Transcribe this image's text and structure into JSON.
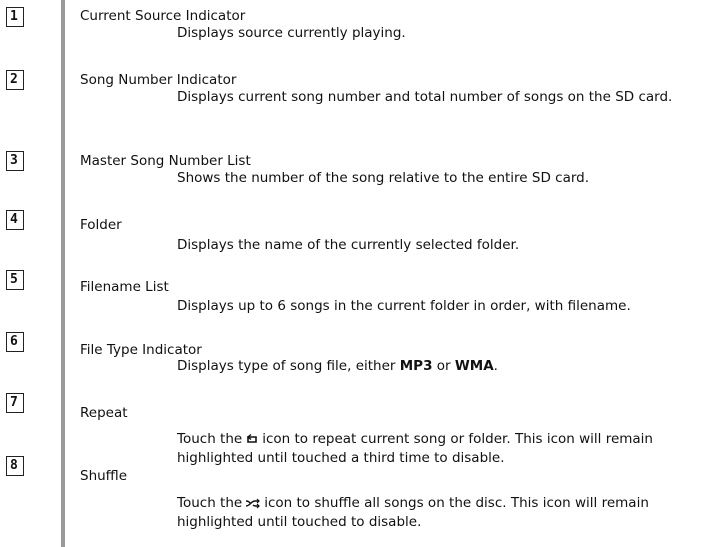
{
  "items": [
    {
      "number": "1",
      "title": "Current Source Indicator",
      "desc": "Displays source currently playing."
    },
    {
      "number": "2",
      "title": "Song Number Indicator",
      "desc": "Displays current song number and total number of songs on the SD card."
    },
    {
      "number": "3",
      "title": "Master Song Number List",
      "desc": "Shows the number of the song relative to the entire SD card."
    },
    {
      "number": "4",
      "title": "Folder",
      "desc": "Displays the name of the currently selected folder."
    },
    {
      "number": "5",
      "title": "Filename List",
      "desc": "Displays up to 6 songs in the current folder in order, with filename."
    },
    {
      "number": "6",
      "title": "File Type Indicator",
      "desc_before": "Displays type of song file, either",
      "format_a": "MP3",
      "desc_or": "or",
      "format_b": "WMA",
      "desc_after": "."
    },
    {
      "number": "7",
      "title": "Repeat",
      "desc_before": "Touch the",
      "icon": "repeat-icon",
      "desc_after": "icon to repeat current song or folder. This icon will remain highlighted until touched a third time to disable."
    },
    {
      "number": "8",
      "title": "Shuffle",
      "desc_before": "Touch the",
      "icon": "shuffle-icon",
      "desc_after": "icon to shuffle all songs on the disc. This icon will remain highlighted until touched to disable."
    }
  ]
}
